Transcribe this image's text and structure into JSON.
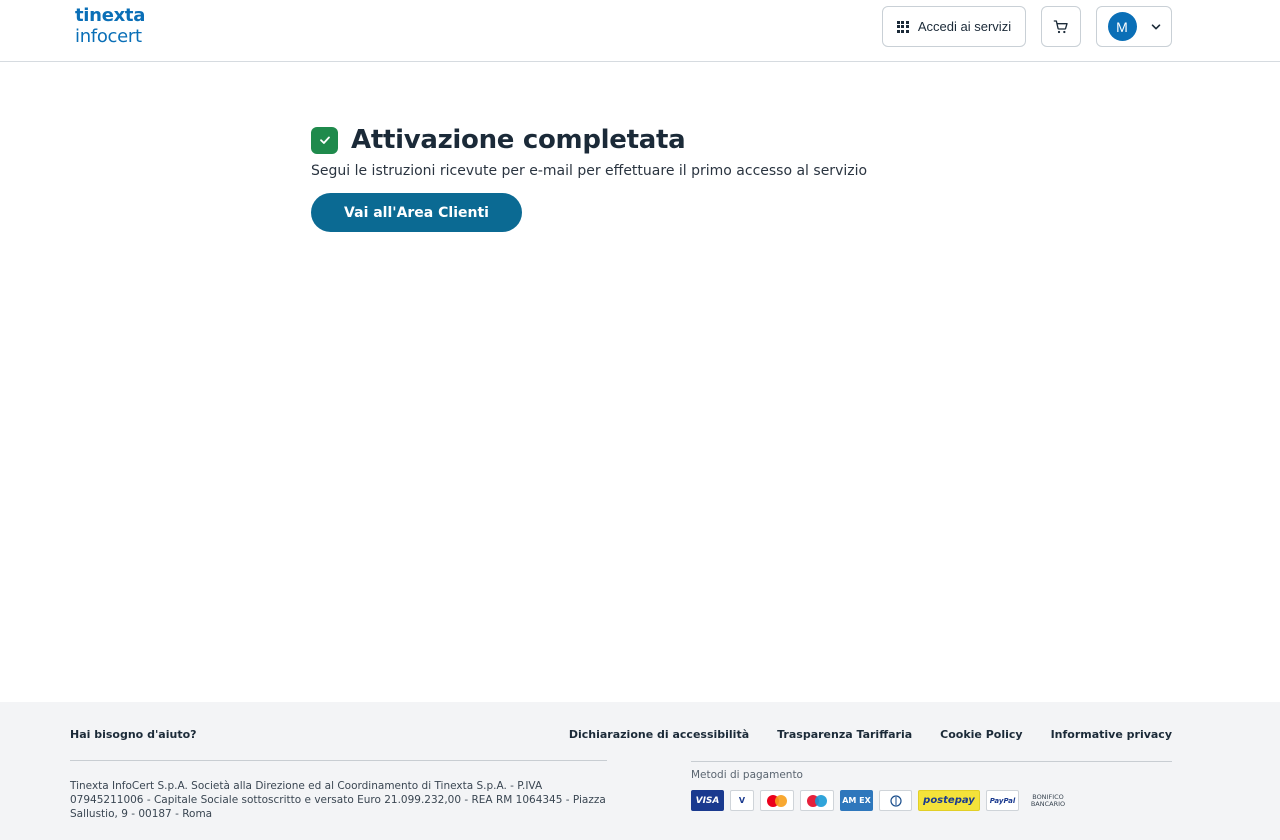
{
  "header": {
    "logo": {
      "line1": "tinexta",
      "line2": "infocert"
    },
    "services_label": "Accedi ai servizi",
    "user_initial": "M"
  },
  "main": {
    "title": "Attivazione completata",
    "subtitle": "Segui le istruzioni ricevute per e-mail per effettuare il primo accesso al servizio",
    "cta_label": "Vai all'Area Clienti"
  },
  "footer": {
    "help_label": "Hai bisogno d'aiuto?",
    "links": [
      "Dichiarazione di accessibilità",
      "Trasparenza Tariffaria",
      "Cookie Policy",
      "Informative privacy"
    ],
    "legal": "Tinexta InfoCert S.p.A. Società alla Direzione ed al Coordinamento di Tinexta S.p.A. - P.IVA 07945211006 - Capitale Sociale sottoscritto e versato Euro 21.099.232,00 - REA RM 1064345 - Piazza Sallustio, 9 - 00187 - Roma",
    "payment_label": "Metodi di pagamento",
    "payment_methods": {
      "visa": "VISA",
      "vpay": "V",
      "amex": "AM EX",
      "postepay": "postepay",
      "paypal": "PayPal",
      "bonifico": "BONIFICO BANCARIO"
    }
  },
  "colors": {
    "brand": "#0a6fb7",
    "cta": "#0b6a93",
    "success": "#1f8a4c",
    "footer_bg": "#f3f4f6"
  },
  "icons": [
    "grid-icon",
    "cart-icon",
    "chevron-down-icon",
    "check-icon"
  ]
}
